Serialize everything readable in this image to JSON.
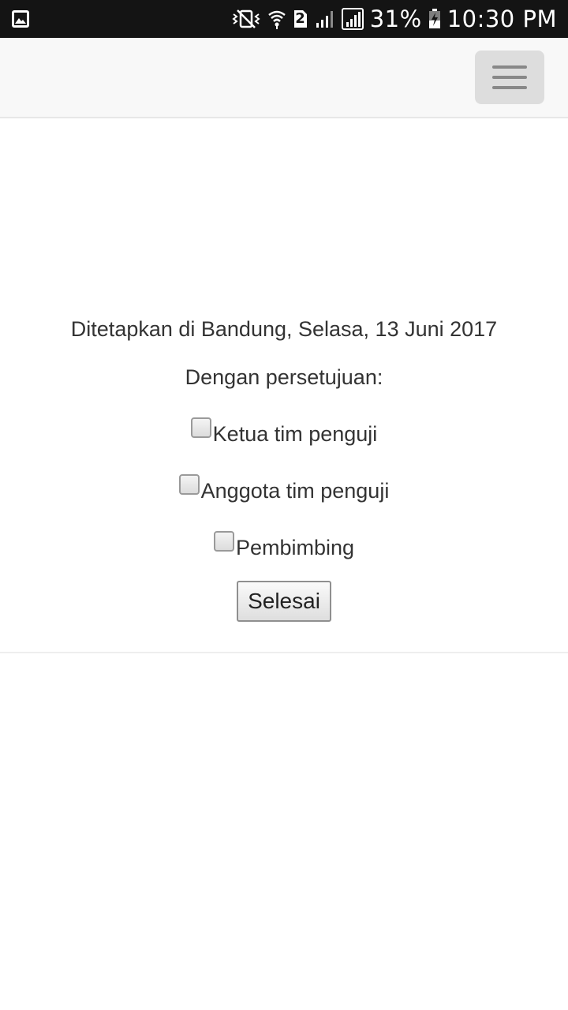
{
  "status_bar": {
    "battery_percent": "31%",
    "time": "10:30 PM",
    "sim_label": "2",
    "icons": [
      "gallery-icon",
      "vibrate-icon",
      "wifi-icon",
      "sim-2-icon",
      "signal-icon",
      "signal-icon",
      "battery-charging-icon"
    ]
  },
  "navbar": {
    "toggle_icon": "hamburger-menu-icon"
  },
  "content": {
    "date_line": "Ditetapkan di Bandung, Selasa, 13 Juni 2017",
    "approval_label": "Dengan persetujuan:",
    "checkboxes": [
      {
        "label": "Ketua tim penguji",
        "checked": false
      },
      {
        "label": "Anggota tim penguji",
        "checked": false
      },
      {
        "label": "Pembimbing",
        "checked": false
      }
    ],
    "submit_label": "Selesai"
  },
  "colors": {
    "status_bar_bg": "#141414",
    "navbar_bg": "#f8f8f8",
    "toggle_bg": "#dddddd",
    "text": "#333333"
  }
}
